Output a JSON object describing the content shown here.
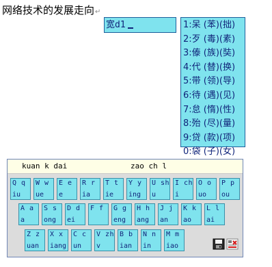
{
  "document": {
    "text": "网络技术的发展走向",
    "paragraph_mark": "↵"
  },
  "composition": {
    "text": "宽d1"
  },
  "candidates": [
    "1:呆 (苯)(拙)",
    "2:歹 (毒)(素)",
    "3:傣 (族)(奘)",
    "4:代 (替)(换)",
    "5:带 (领)(导)",
    "6:待 (遇)(见)",
    "7:怠 (惰)(性)",
    "8:殆 (尽)(量)",
    "9:贷 (款)(项)",
    "0:袋 (子)(女)"
  ],
  "keyboard": {
    "strip_left": "kuan k dai",
    "strip_right": "zao ch l",
    "rows": [
      [
        {
          "top": "Q q",
          "bottom": "iu"
        },
        {
          "top": "W w",
          "bottom": "ue"
        },
        {
          "top": "E e",
          "bottom": "e"
        },
        {
          "top": "R r",
          "bottom": "ia"
        },
        {
          "top": "T t",
          "bottom": "ie"
        },
        {
          "top": "Y y",
          "bottom": "ing"
        },
        {
          "top": "U sh",
          "bottom": "u"
        },
        {
          "top": "I ch",
          "bottom": "i"
        },
        {
          "top": "O o",
          "bottom": "uo"
        },
        {
          "top": "P p",
          "bottom": "ou"
        }
      ],
      [
        {
          "top": "A a",
          "bottom": "a"
        },
        {
          "top": "S s",
          "bottom": "ong"
        },
        {
          "top": "D d",
          "bottom": "ei"
        },
        {
          "top": "F f",
          "bottom": ""
        },
        {
          "top": "G g",
          "bottom": "eng"
        },
        {
          "top": "H h",
          "bottom": "ang"
        },
        {
          "top": "J j",
          "bottom": "an"
        },
        {
          "top": "K k",
          "bottom": "ao"
        },
        {
          "top": "L l",
          "bottom": "ai"
        }
      ],
      [
        {
          "top": "Z z",
          "bottom": "uan"
        },
        {
          "top": "X x",
          "bottom": "iang"
        },
        {
          "top": "C c",
          "bottom": "un"
        },
        {
          "top": "V zh",
          "bottom": "v"
        },
        {
          "top": "B b",
          "bottom": "ian"
        },
        {
          "top": "N n",
          "bottom": "in"
        },
        {
          "top": "M m",
          "bottom": "iao"
        }
      ]
    ],
    "controls": [
      {
        "icon": "save-icon"
      },
      {
        "icon": "settings-icon"
      }
    ]
  }
}
